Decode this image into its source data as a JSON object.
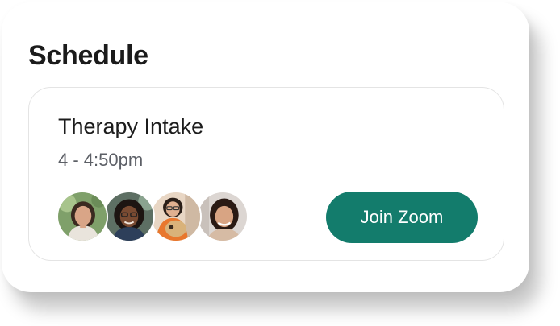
{
  "schedule": {
    "title": "Schedule",
    "event": {
      "title": "Therapy Intake",
      "time": "4 - 4:50pm",
      "participants": [
        {
          "icon": "participant-avatar-1"
        },
        {
          "icon": "participant-avatar-2"
        },
        {
          "icon": "participant-avatar-3"
        },
        {
          "icon": "participant-avatar-4"
        }
      ],
      "join_label": "Join Zoom"
    }
  },
  "colors": {
    "accent": "#137c6c",
    "text_primary": "#1c1c1c",
    "text_secondary": "#5c5f66",
    "card_border": "#e4e4e4"
  }
}
